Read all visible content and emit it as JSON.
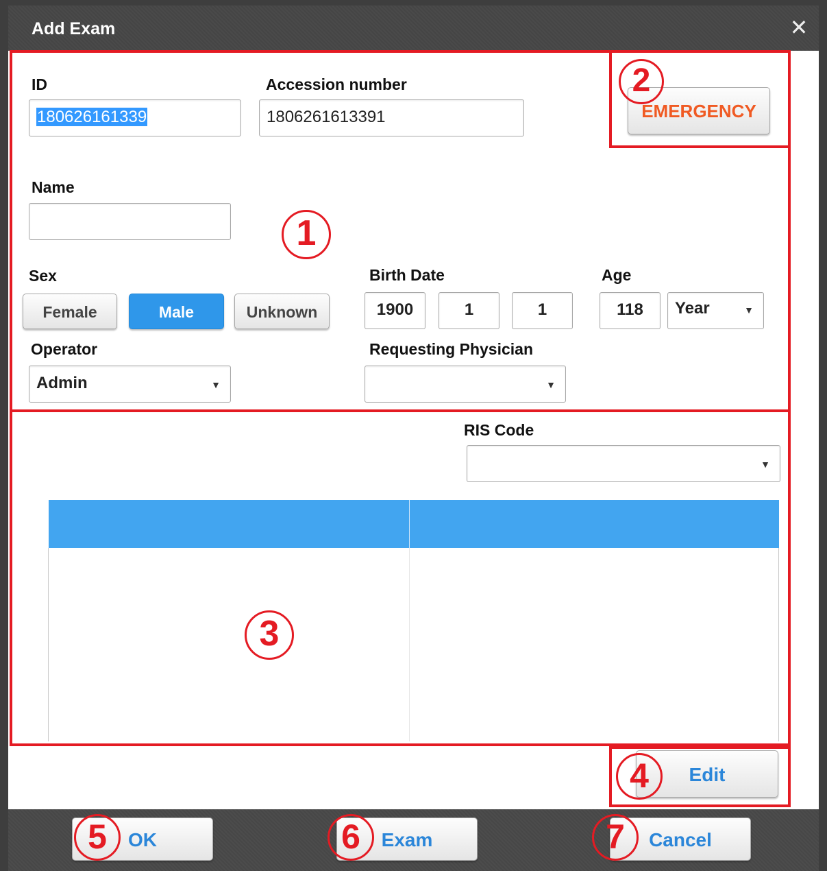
{
  "window": {
    "title": "Add Exam",
    "close_glyph": "✕"
  },
  "patient": {
    "id_label": "ID",
    "id_value": "180626161339",
    "accession_label": "Accession number",
    "accession_value": "1806261613391",
    "name_label": "Name",
    "name_value": ""
  },
  "sex": {
    "label": "Sex",
    "options": [
      "Female",
      "Male",
      "Unknown"
    ],
    "selected": "Male"
  },
  "birth_date": {
    "label": "Birth Date",
    "year": "1900",
    "month": "1",
    "day": "1"
  },
  "age": {
    "label": "Age",
    "value": "118",
    "unit": "Year"
  },
  "operator": {
    "label": "Operator",
    "value": "Admin"
  },
  "physician": {
    "label": "Requesting Physician",
    "value": ""
  },
  "emergency_label": "EMERGENCY",
  "ris": {
    "label": "RIS Code",
    "value": ""
  },
  "table": {
    "columns": [
      "",
      ""
    ],
    "rows": []
  },
  "edit_label": "Edit",
  "footer": {
    "ok_label": "OK",
    "exam_label": "Exam",
    "cancel_label": "Cancel"
  },
  "annotations": [
    "1",
    "2",
    "3",
    "4",
    "5",
    "6",
    "7"
  ],
  "colors": {
    "accent": "#2f97ea",
    "table_header": "#42a5f0",
    "annotation": "#e41b23",
    "emergency": "#f05a23"
  }
}
